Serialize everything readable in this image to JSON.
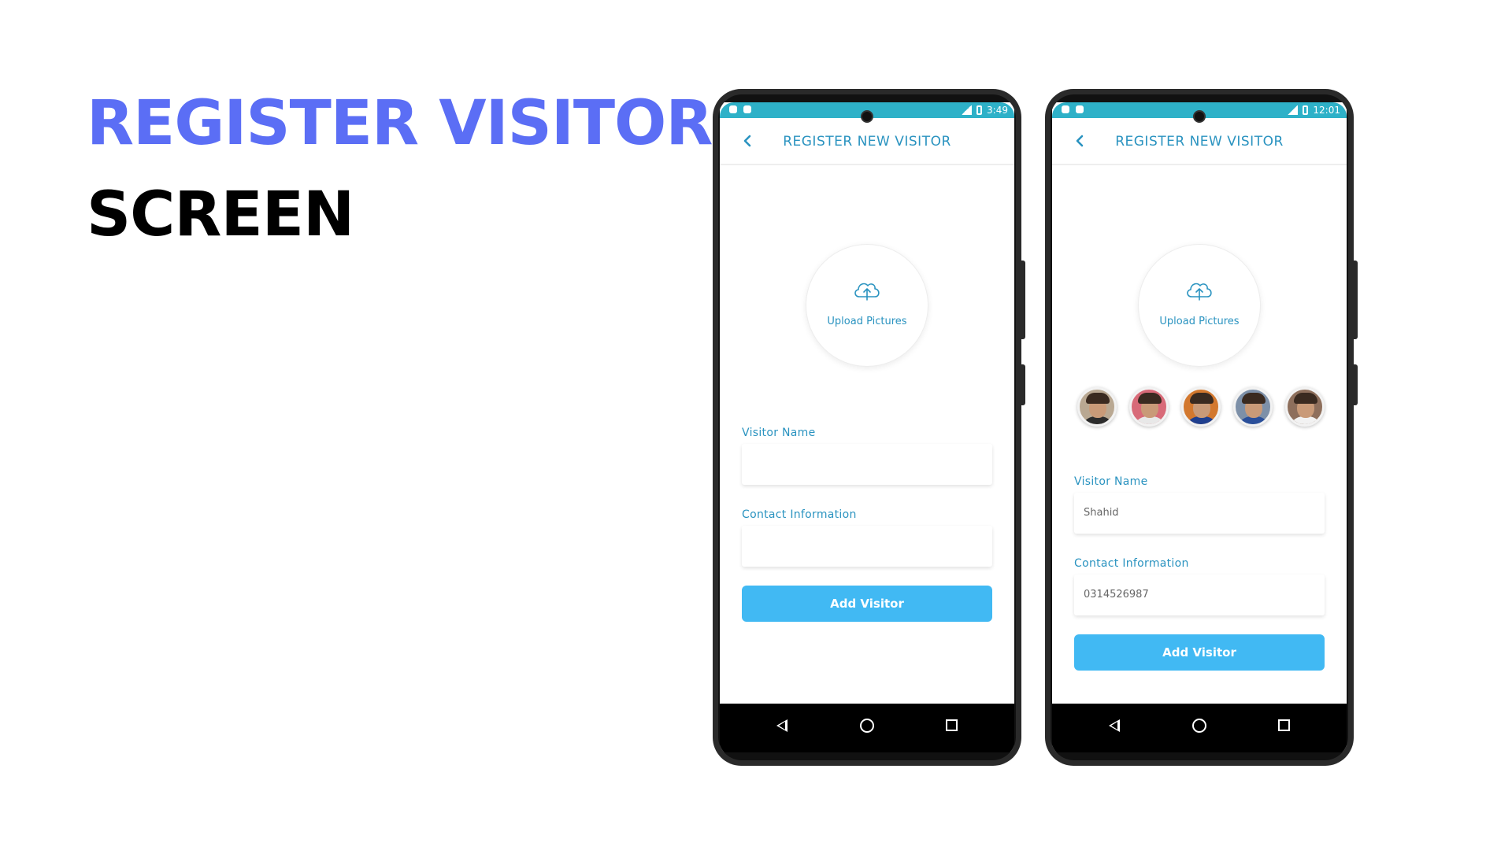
{
  "headline": {
    "line1": "REGISTER VISITOR",
    "line2": "SCREEN"
  },
  "colors": {
    "headline_accent": "#5b6ef5",
    "app_teal": "#2eb1c8",
    "app_blue_text": "#2a93c0",
    "button_blue": "#41b9f3"
  },
  "phones": [
    {
      "status_time": "3:49",
      "appbar_title": "REGISTER NEW VISITOR",
      "upload_label": "Upload Pictures",
      "visitor_name_label": "Visitor Name",
      "visitor_name_value": "",
      "contact_label": "Contact Information",
      "contact_value": "",
      "button_label": "Add Visitor"
    },
    {
      "status_time": "12:01",
      "appbar_title": "REGISTER NEW VISITOR",
      "upload_label": "Upload Pictures",
      "visitor_name_label": "Visitor Name",
      "visitor_name_value": "Shahid",
      "contact_label": "Contact Information",
      "contact_value": "0314526987",
      "button_label": "Add Visitor",
      "avatars_count": 5
    }
  ],
  "icons": {
    "back": "chevron-left-icon",
    "upload": "cloud-upload-icon",
    "nav_back": "triangle-back-icon",
    "nav_home": "circle-home-icon",
    "nav_recent": "square-recent-icon"
  }
}
